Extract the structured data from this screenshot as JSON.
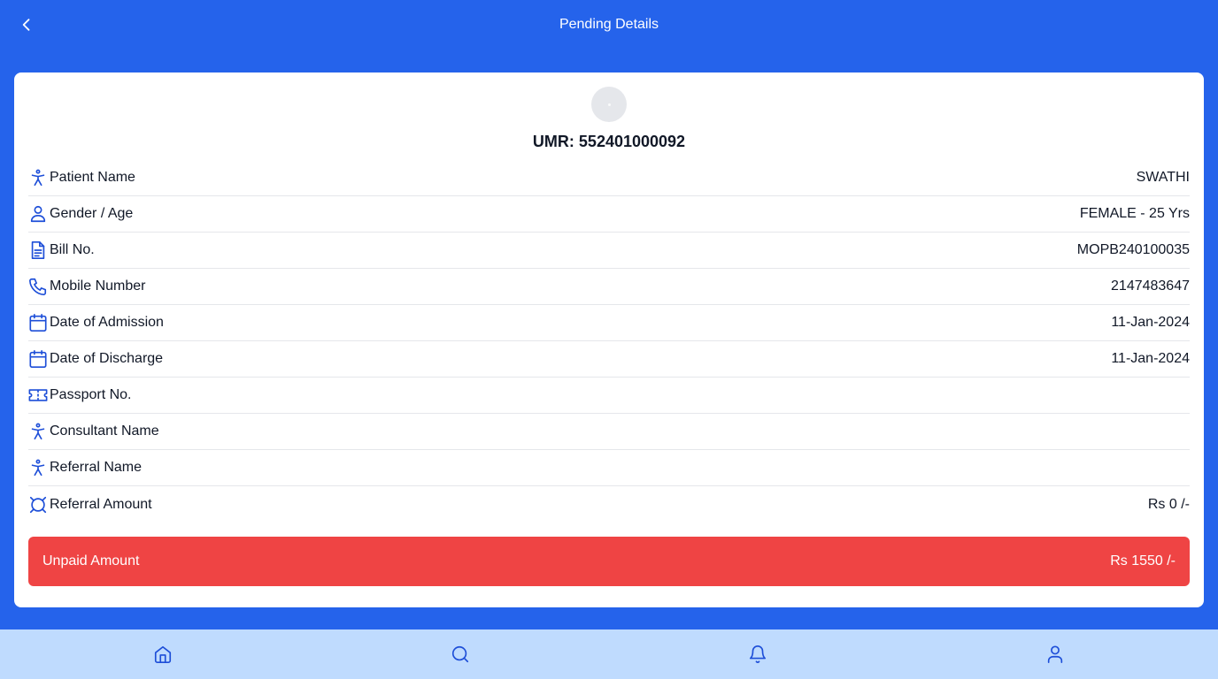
{
  "header": {
    "title": "Pending Details",
    "back_icon": "chevron-left-icon"
  },
  "patient": {
    "umr_label": "UMR:",
    "umr_value": "552401000092"
  },
  "details": [
    {
      "icon": "person-standing-icon",
      "label": "Patient Name",
      "value": "SWATHI"
    },
    {
      "icon": "user-icon",
      "label": "Gender / Age",
      "value": "FEMALE - 25 Yrs"
    },
    {
      "icon": "file-text-icon",
      "label": "Bill No.",
      "value": "MOPB240100035"
    },
    {
      "icon": "phone-icon",
      "label": "Mobile Number",
      "value": "2147483647"
    },
    {
      "icon": "calendar-icon",
      "label": "Date of Admission",
      "value": "11-Jan-2024"
    },
    {
      "icon": "calendar-icon",
      "label": "Date of Discharge",
      "value": "11-Jan-2024"
    },
    {
      "icon": "ticket-icon",
      "label": "Passport No.",
      "value": ""
    },
    {
      "icon": "person-standing-icon",
      "label": "Consultant Name",
      "value": ""
    },
    {
      "icon": "person-standing-icon",
      "label": "Referral Name",
      "value": ""
    },
    {
      "icon": "currency-icon",
      "label": "Referral Amount",
      "value": "Rs 0 /-"
    }
  ],
  "unpaid": {
    "label": "Unpaid Amount",
    "value": "Rs 1550 /-"
  },
  "nav": {
    "items": [
      "home-icon",
      "search-icon",
      "bell-icon",
      "user-icon"
    ]
  },
  "colors": {
    "primary": "#2563eb",
    "icon": "#1d4ed8",
    "danger": "#ef4444",
    "nav_bg": "#bfdbfe"
  }
}
